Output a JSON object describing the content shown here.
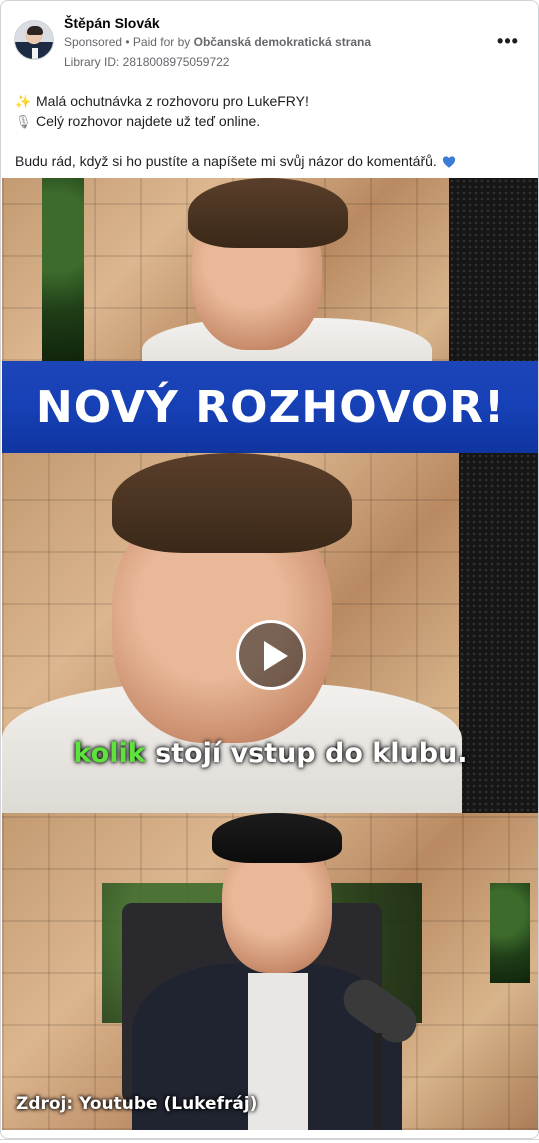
{
  "post": {
    "author_name": "Štěpán Slovák",
    "sponsored_label": "Sponsored",
    "paid_for_prefix": " • Paid for by ",
    "payer": "Občanská demokratická strana",
    "library_id": "Library ID: 2818008975059722",
    "more_label": "•••",
    "text_lines": [
      "Malá ochutnávka z rozhovoru pro LukeFRY!",
      "Celý rozhovor najdete už teď online.",
      "Budu rád, když si ho pustíte a napíšete mi svůj názor do komentářů."
    ],
    "icons": [
      "sparkles-icon",
      "microphone-icon",
      "blue-heart-icon"
    ],
    "heart_color": "#3d7bd9"
  },
  "video": {
    "banner_text": "NOVÝ ROZHOVOR!",
    "caption_highlight": "kolik",
    "caption_rest": " stojí vstup do klubu.",
    "source_text": "Zdroj: Youtube (Lukefráj)",
    "banner_color": "#1640b5",
    "highlight_color": "#5ee33c"
  }
}
